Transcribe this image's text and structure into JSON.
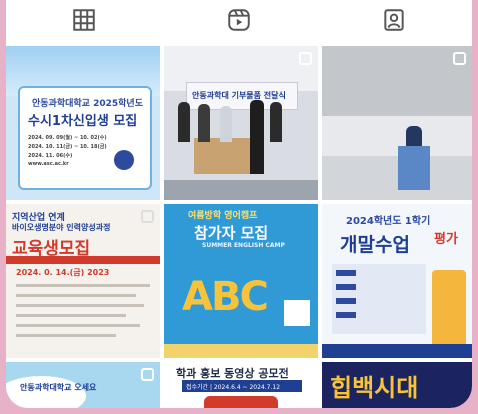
{
  "tabs": [
    {
      "icon": "grid-icon"
    },
    {
      "icon": "reels-icon"
    },
    {
      "icon": "tagged-icon"
    }
  ],
  "posts": {
    "p1": {
      "school": "안동과학대학교 2025학년도",
      "title": "수시1차신입생 모집",
      "rows": [
        "2024. 09. 09(월) ~ 10. 02(수)",
        "2024. 10. 11(금) ~ 10. 18(금)",
        "2024. 11. 06(수)",
        "www.asc.ac.kr"
      ]
    },
    "p2": {
      "banner": "안동과학대 기부물품 전달식"
    },
    "p3": {},
    "p4": {
      "line1": "지역산업 연계",
      "line2": "바이오생명분야 인력양성과정",
      "title": "교육생모집",
      "date": "2024. 0. 14.(금) 2023"
    },
    "p5": {
      "top": "여름방학 영어캠프",
      "title": "참가자 모집",
      "sub": "SUMMER ENGLISH CAMP",
      "abc": "ABC"
    },
    "p6": {
      "year": "2024학년도 1학기",
      "title1": "개말수업",
      "title2": "평가"
    },
    "p7": {
      "text": "안동과학대학교 오세요"
    },
    "p8": {
      "title": "학과 홍보 동영상 공모전",
      "date": "접수기간 | 2024.6.4 ~ 2024.7.12"
    },
    "p9": {
      "title": "힙백시대"
    }
  }
}
